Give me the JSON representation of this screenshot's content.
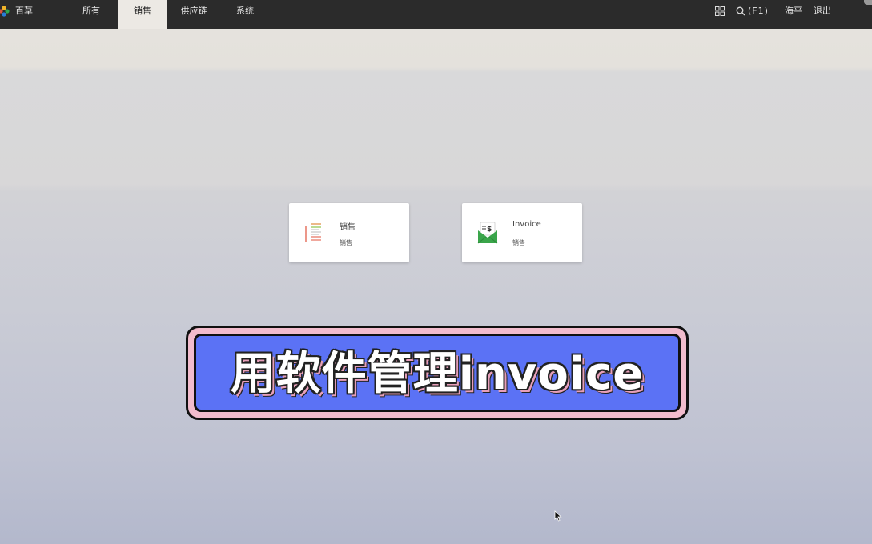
{
  "topbar": {
    "brand": "百草",
    "nav": [
      {
        "label": "所有",
        "active": false
      },
      {
        "label": "销售",
        "active": true
      },
      {
        "label": "供应链",
        "active": false
      },
      {
        "label": "系统",
        "active": false
      }
    ],
    "search_shortcut": "(F1)",
    "user": "海平",
    "logout": "退出"
  },
  "cards": [
    {
      "title": "销售",
      "subtitle": "销售",
      "icon": "sales-document-icon"
    },
    {
      "title": "Invoice",
      "subtitle": "销售",
      "icon": "invoice-envelope-icon"
    }
  ],
  "banner": {
    "text": "用软件管理invoice",
    "colors": {
      "outer": "#f2bccd",
      "inner": "#5b72f5",
      "outline": "#111111"
    }
  },
  "colors": {
    "topbar_bg": "#2b2b2b",
    "active_tab_bg": "#ece9e4"
  }
}
